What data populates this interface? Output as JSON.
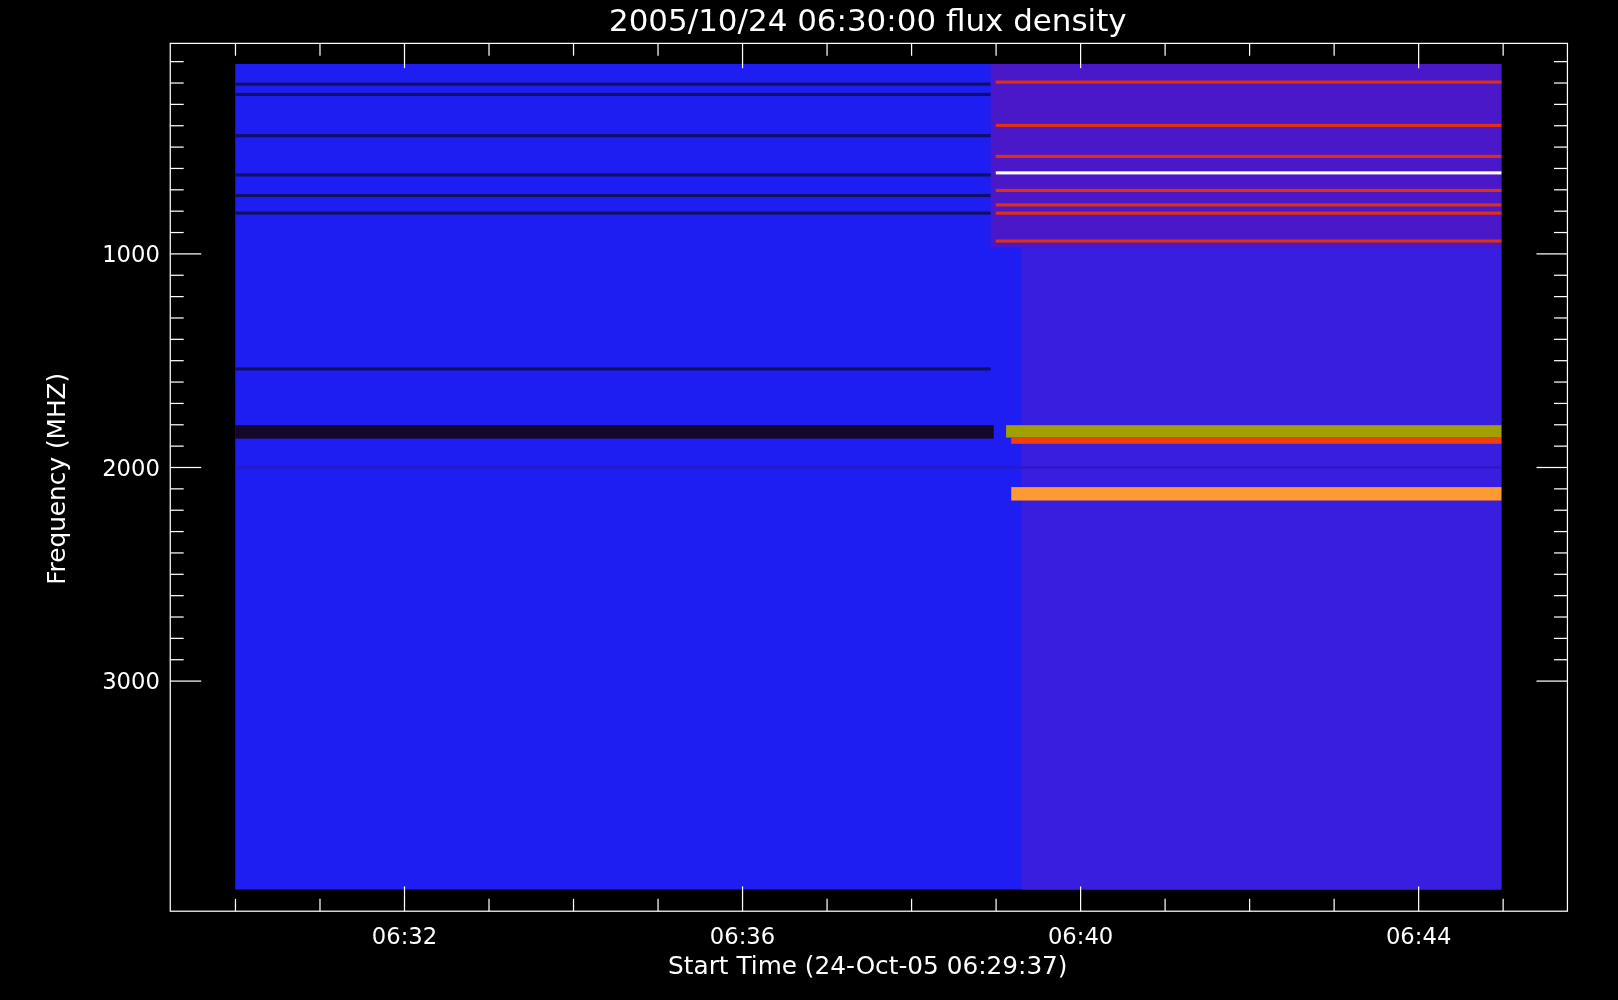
{
  "title": "2005/10/24 06:30:00 flux density",
  "x_axis": {
    "label": "Start Time (24-Oct-05 06:29:37)",
    "ticks": [
      "06:32",
      "06:36",
      "06:40",
      "06:44"
    ]
  },
  "y_axis": {
    "label": "Frequency (MHZ)",
    "ticks": [
      "1000",
      "2000",
      "3000"
    ]
  }
}
